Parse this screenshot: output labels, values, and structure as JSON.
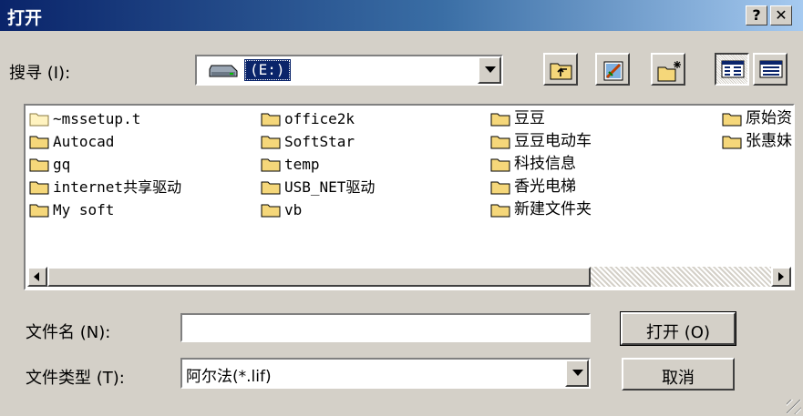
{
  "window": {
    "title": "打开",
    "help_label": "?",
    "close_label": "✕"
  },
  "look_in": {
    "label": "搜寻 (I):",
    "value": "(E:)"
  },
  "toolbar": [
    {
      "name": "up-one-level-button",
      "icon": "folder-up-icon"
    },
    {
      "name": "desktop-button",
      "icon": "desktop-icon"
    },
    {
      "name": "new-folder-button",
      "icon": "new-folder-icon"
    },
    {
      "name": "list-view-button",
      "icon": "list-view-icon",
      "pressed": true
    },
    {
      "name": "details-view-button",
      "icon": "details-view-icon"
    }
  ],
  "files": {
    "col1": [
      "~mssetup.t",
      "Autocad",
      "gq",
      "internet共享驱动",
      "My soft"
    ],
    "col2": [
      "office2k",
      "SoftStar",
      "temp",
      "USB_NET驱动",
      "vb"
    ],
    "col3": [
      "豆豆",
      "豆豆电动车",
      "科技信息",
      "香光电梯",
      "新建文件夹"
    ],
    "col4": [
      "原始资",
      "张惠妹"
    ]
  },
  "filename": {
    "label": "文件名 (N):",
    "value": ""
  },
  "filetype": {
    "label": "文件类型 (T):",
    "value": "阿尔法(*.lif)"
  },
  "buttons": {
    "open": "打开 (O)",
    "cancel": "取消"
  },
  "colors": {
    "title_start": "#0a246a",
    "title_end": "#a6caf0",
    "face": "#d4d0c8",
    "folder": "#f5d77a"
  }
}
